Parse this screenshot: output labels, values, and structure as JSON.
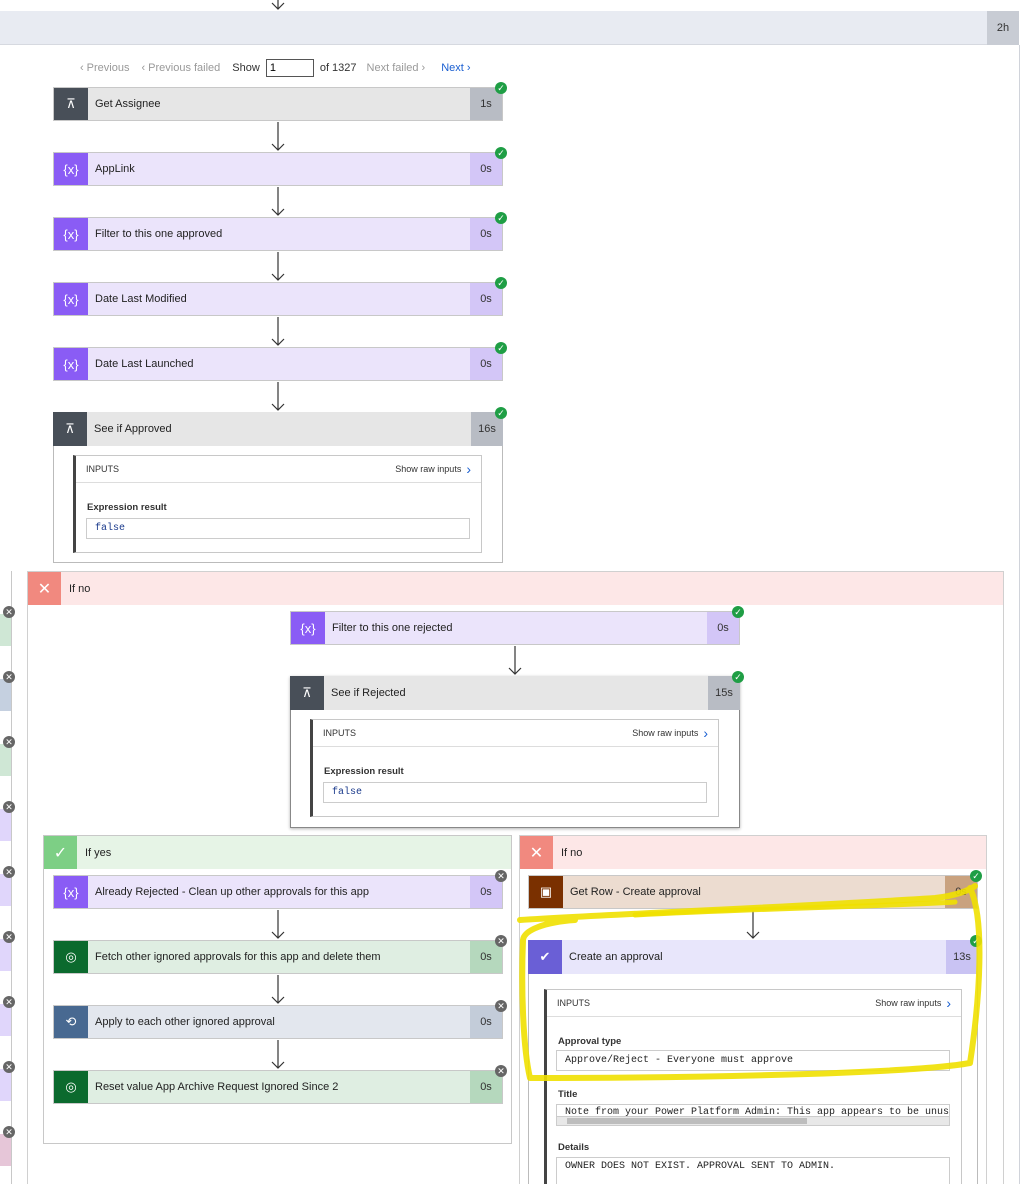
{
  "top": {
    "duration": "2h"
  },
  "pager": {
    "previous": "Previous",
    "previous_failed": "Previous failed",
    "show": "Show",
    "current_page": "1",
    "of_total": "of 1327",
    "next_failed": "Next failed",
    "next": "Next"
  },
  "main_actions": [
    {
      "name": "Get Assignee",
      "duration": "1s",
      "icon": "condition-icon",
      "color": "#484f58"
    },
    {
      "name": "AppLink",
      "duration": "0s",
      "icon": "variable-icon",
      "color": "#770bd6"
    },
    {
      "name": "Filter to this one approved",
      "duration": "0s",
      "icon": "variable-icon",
      "color": "#770bd6"
    },
    {
      "name": "Date Last Modified",
      "duration": "0s",
      "icon": "variable-icon",
      "color": "#770bd6"
    },
    {
      "name": "Date Last Launched",
      "duration": "0s",
      "icon": "variable-icon",
      "color": "#770bd6"
    },
    {
      "name": "See if Approved",
      "duration": "16s",
      "icon": "condition-icon",
      "color": "#484f58"
    }
  ],
  "approved_inputs": {
    "header": "INPUTS",
    "raw_link": "Show raw inputs",
    "result_label": "Expression result",
    "result_value": "false"
  },
  "if_no_outer": {
    "label": "If no"
  },
  "inner_actions": [
    {
      "name": "Filter to this one rejected",
      "duration": "0s"
    },
    {
      "name": "See if Rejected",
      "duration": "15s"
    }
  ],
  "rejected_inputs": {
    "header": "INPUTS",
    "raw_link": "Show raw inputs",
    "result_label": "Expression result",
    "result_value": "false"
  },
  "if_yes": {
    "label": "If yes",
    "actions": [
      {
        "name": "Already Rejected - Clean up other approvals for this app",
        "duration": "0s"
      },
      {
        "name": "Fetch other ignored approvals for this app and delete them",
        "duration": "0s"
      },
      {
        "name": "Apply to each other ignored approval",
        "duration": "0s"
      },
      {
        "name": "Reset value App Archive Request Ignored Since 2",
        "duration": "0s"
      }
    ]
  },
  "if_no_inner": {
    "label": "If no",
    "actions": [
      {
        "name": "Get Row - Create approval",
        "duration": "0s"
      },
      {
        "name": "Create an approval",
        "duration": "13s"
      }
    ]
  },
  "approval_inputs": {
    "header": "INPUTS",
    "raw_link": "Show raw inputs",
    "approval_type_label": "Approval type",
    "approval_type_value": "Approve/Reject - Everyone must approve",
    "title_label": "Title",
    "title_value": "Note from your Power Platform Admin: This app appears to be unused;",
    "details_label": "Details",
    "details_value": "OWNER DOES NOT EXIST. APPROVAL SENT TO ADMIN."
  },
  "colors": {
    "condition": "#484f58",
    "variable": "#770bd6",
    "dataverse": "#0b6a2e",
    "loop": "#486991",
    "approval": "#6a5fd6",
    "getrow": "#7a3000",
    "success": "#1f9e45",
    "highlight": "#f0e000"
  }
}
